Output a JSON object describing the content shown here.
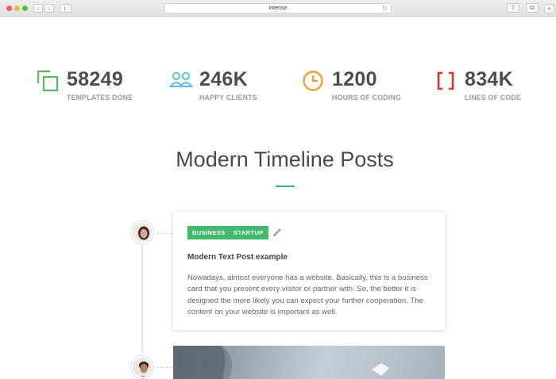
{
  "browser": {
    "address": "intense",
    "nav_back": "‹",
    "nav_forward": "›",
    "reload": "↻",
    "share": "⇧",
    "tabs": "⧉",
    "new_tab": "+"
  },
  "stats": [
    {
      "value": "58249",
      "label": "TEMPLATES DONE",
      "icon": "copy-icon",
      "color": "#5cb85c"
    },
    {
      "value": "246K",
      "label": "HAPPY CLIENTS",
      "icon": "users-icon",
      "color": "#5bc0de"
    },
    {
      "value": "1200",
      "label": "HOURS OF CODING",
      "icon": "clock-icon",
      "color": "#f0a030"
    },
    {
      "value": "834K",
      "label": "LINES OF CODE",
      "icon": "brackets-icon",
      "color": "#e03030"
    }
  ],
  "section": {
    "title": "Modern Timeline Posts",
    "accent": "#3cb371"
  },
  "post": {
    "tags": [
      "BUSINESS",
      "STARTUP"
    ],
    "tag_color": "#42b96f",
    "icon": "pencil-icon",
    "title": "Modern Text Post example",
    "body": "Nowadays, almost everyone has a website. Basically, this is a business card that you present every visitor or partner with. So, the better it is designed the more likely you can expect your further cooperation. The content on your website is important as well."
  }
}
